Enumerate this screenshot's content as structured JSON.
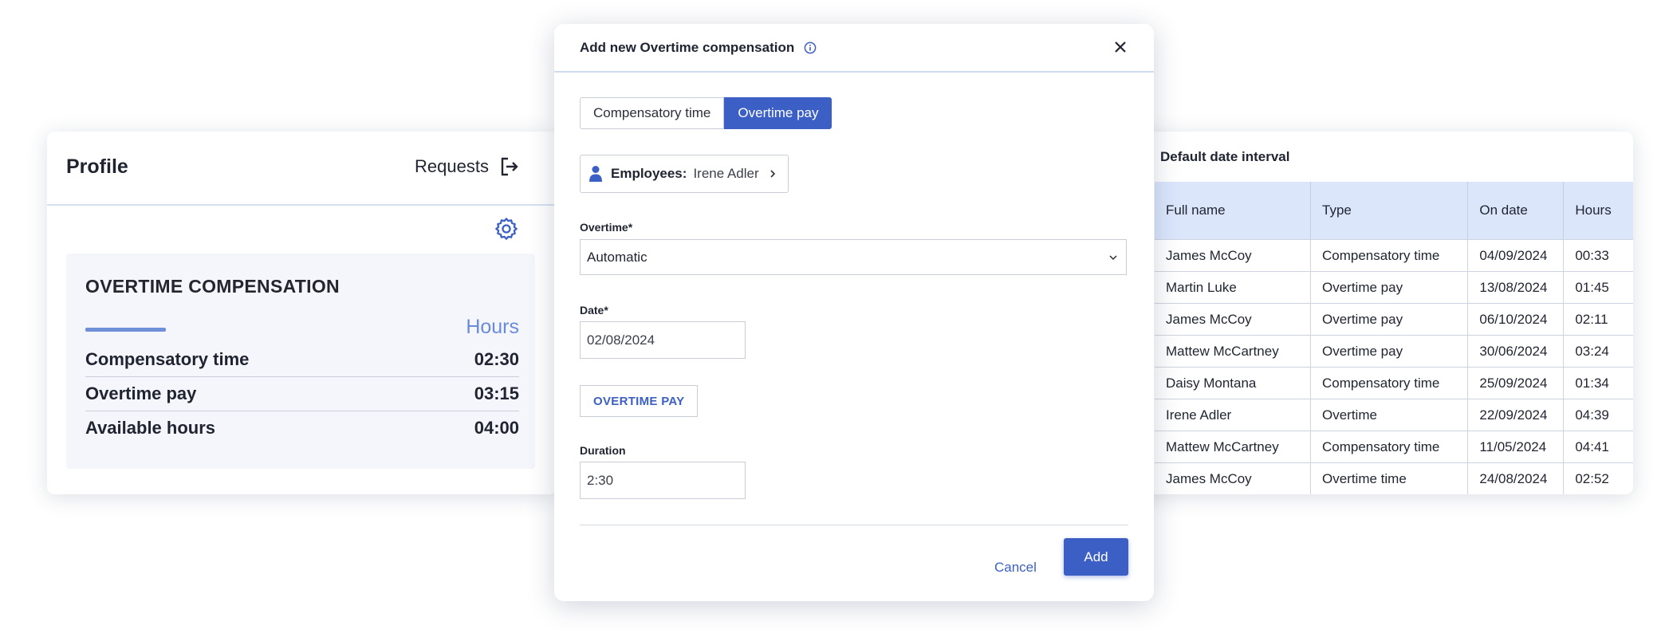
{
  "profile": {
    "title": "Profile",
    "requests_label": "Requests",
    "panel": {
      "title": "OVERTIME COMPENSATION",
      "hours_label": "Hours",
      "rows": [
        {
          "label": "Compensatory time",
          "value": "02:30"
        },
        {
          "label": "Overtime pay",
          "value": "03:15"
        },
        {
          "label": "Available hours",
          "value": "04:00"
        }
      ]
    }
  },
  "table": {
    "caption": "Default date interval",
    "columns": [
      "Full name",
      "Type",
      "On date",
      "Hours"
    ],
    "rows": [
      [
        "James  McCoy",
        "Compensatory time",
        "04/09/2024",
        "00:33"
      ],
      [
        "Martin Luke",
        "Overtime pay",
        "13/08/2024",
        "01:45"
      ],
      [
        "James  McCoy",
        "Overtime pay",
        "06/10/2024",
        "02:11"
      ],
      [
        "Mattew McCartney",
        "Overtime pay",
        "30/06/2024",
        "03:24"
      ],
      [
        "Daisy Montana",
        "Compensatory time",
        "25/09/2024",
        "01:34"
      ],
      [
        "Irene Adler",
        "Overtime",
        "22/09/2024",
        "04:39"
      ],
      [
        "Mattew McCartney",
        "Compensatory time",
        "11/05/2024",
        "04:41"
      ],
      [
        "James  McCoy",
        "Overtime time",
        "24/08/2024",
        "02:52"
      ]
    ]
  },
  "modal": {
    "title": "Add new Overtime compensation",
    "tabs": [
      "Compensatory time",
      "Overtime pay"
    ],
    "selected_tab": "Overtime pay",
    "employees_label": "Employees:",
    "employee_value": "Irene Adler",
    "overtime_label": "Overtime*",
    "overtime_value": "Automatic",
    "date_label": "Date*",
    "date_value": "02/08/2024",
    "tag_label": "OVERTIME PAY",
    "duration_label": "Duration",
    "duration_value": "2:30",
    "cancel_label": "Cancel",
    "add_label": "Add"
  },
  "colors": {
    "accent": "#3b5fc4",
    "header_bg": "#dbe6fb",
    "panel_bg": "#f4f6fb",
    "hours_text": "#6b8bd8"
  }
}
